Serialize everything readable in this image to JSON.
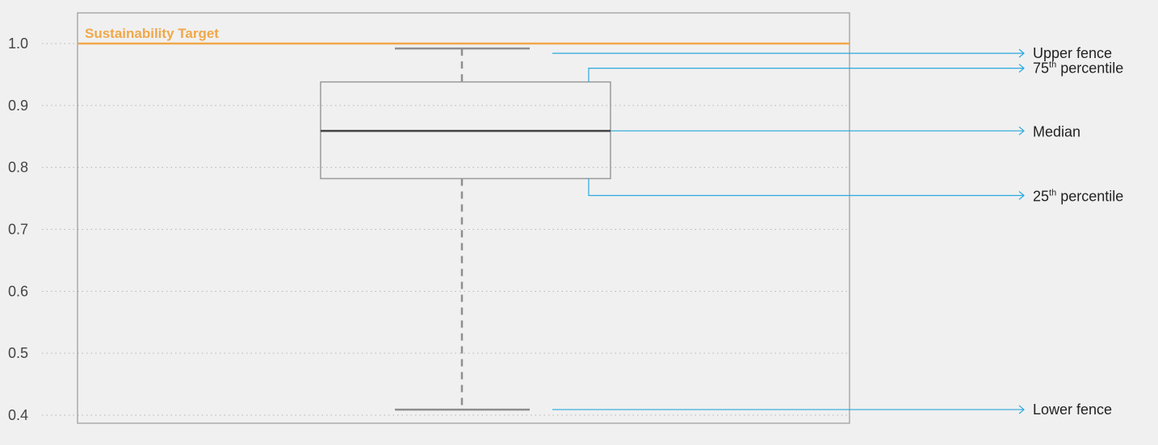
{
  "chart_data": {
    "type": "box",
    "title": "",
    "xlabel": "",
    "ylabel": "",
    "ylim": [
      0.4,
      1.0
    ],
    "yticks": [
      1.0,
      0.9,
      0.8,
      0.7,
      0.6,
      0.5,
      0.4
    ],
    "ytick_labels": [
      "1.0",
      "0.9",
      "0.8",
      "0.7",
      "0.6",
      "0.5",
      "0.4"
    ],
    "grid": "dotted horizontal",
    "box": {
      "upper_fence": 0.992,
      "q3": 0.938,
      "median": 0.859,
      "q1": 0.782,
      "lower_fence": 0.409
    },
    "reference_line": {
      "label": "Sustainability Target",
      "value": 1.0,
      "color": "#f0a84a"
    },
    "annotations": [
      {
        "key": "upper",
        "text": "Upper fence",
        "sup": ""
      },
      {
        "key": "q3",
        "text": "75",
        "sup": "th",
        "suffix": " percentile"
      },
      {
        "key": "median",
        "text": "Median",
        "sup": ""
      },
      {
        "key": "q1",
        "text": "25",
        "sup": "th",
        "suffix": " percentile"
      },
      {
        "key": "lower",
        "text": "Lower fence",
        "sup": ""
      }
    ],
    "colors": {
      "box_stroke": "#9a9a9a",
      "median": "#444444",
      "whisker": "#8e8e8e",
      "annotation": "#29a9e0",
      "grid": "#b5b5b5",
      "frame": "#9a9a9a"
    }
  }
}
